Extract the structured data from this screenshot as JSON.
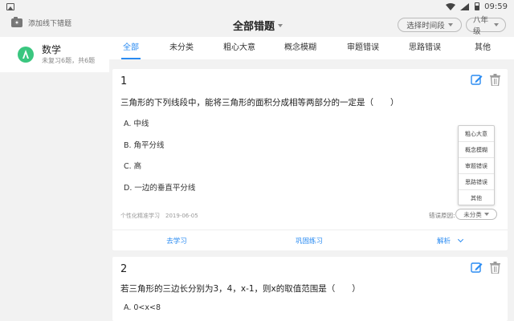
{
  "statusbar": {
    "time": "09:59"
  },
  "header": {
    "add_offline": "添加线下错题",
    "title": "全部错题",
    "time_filter": "选择时间段",
    "grade": "八年级"
  },
  "sidebar": {
    "subject": {
      "name": "数学",
      "sub": "未复习6题，共6题",
      "color": "#3ac67f"
    }
  },
  "tabs": [
    "全部",
    "未分类",
    "粗心大意",
    "概念模糊",
    "审题错误",
    "思路错误",
    "其他"
  ],
  "accent": "#2a8bf2",
  "questions": [
    {
      "num": "1",
      "stem": "三角形的下列线段中，能将三角形的面积分成相等两部分的一定是（　　）",
      "options": [
        "A.  中线",
        "B.  角平分线",
        "C.  高",
        "D.  一边的垂直平分线"
      ],
      "meta": "个性化精准学习　2019-06-05",
      "reason_label": "错误原因:",
      "reason_value": "未分类",
      "actions": [
        "去学习",
        "巩固练习",
        "解析"
      ]
    },
    {
      "num": "2",
      "stem": "若三角形的三边长分别为3，4，x-1，则x的取值范围是（　　）",
      "options": [
        "A.  0<x<8"
      ]
    }
  ],
  "popup_menu": [
    "粗心大意",
    "概念模糊",
    "审题错误",
    "思路错误",
    "其他"
  ],
  "icons": {
    "gallery": "gallery-icon",
    "wifi": "wifi-icon",
    "signal": "signal-icon",
    "battery": "battery-icon",
    "camera": "camera-icon",
    "edit": "edit-icon",
    "trash": "trash-icon"
  }
}
